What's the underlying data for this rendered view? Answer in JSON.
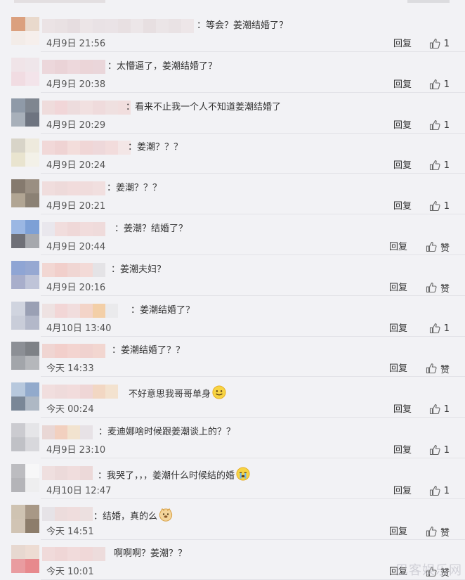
{
  "comments": [
    {
      "text": "：等会？姜潮结婚了？",
      "time": "4月9日 21:56",
      "reply": "回复",
      "like": "1",
      "emoji": ""
    },
    {
      "text": "：太懵逼了，姜潮结婚了？",
      "time": "4月9日 20:38",
      "reply": "回复",
      "like": "1",
      "emoji": ""
    },
    {
      "text": "：看来不止我一个人不知道姜潮结婚了",
      "time": "4月9日 20:29",
      "reply": "回复",
      "like": "1",
      "emoji": ""
    },
    {
      "text": "：姜潮？？？",
      "time": "4月9日 20:24",
      "reply": "回复",
      "like": "1",
      "emoji": ""
    },
    {
      "text": "：姜潮？？？",
      "time": "4月9日 20:21",
      "reply": "回复",
      "like": "1",
      "emoji": ""
    },
    {
      "text": "：姜潮？结婚了？",
      "time": "4月9日 20:44",
      "reply": "回复",
      "like": "赞",
      "emoji": ""
    },
    {
      "text": "：姜潮夫妇？",
      "time": "4月9日 20:16",
      "reply": "回复",
      "like": "赞",
      "emoji": ""
    },
    {
      "text": "：姜潮结婚了？",
      "time": "4月10日 13:40",
      "reply": "回复",
      "like": "1",
      "emoji": ""
    },
    {
      "text": "：姜潮结婚了？？",
      "time": "今天 14:33",
      "reply": "回复",
      "like": "赞",
      "emoji": ""
    },
    {
      "text": "不好意思我哥哥单身",
      "time": "今天 00:24",
      "reply": "回复",
      "like": "1",
      "emoji": "smile"
    },
    {
      "text": "：麦迪娜啥时候跟姜潮谈上的？？",
      "time": "4月9日 23:10",
      "reply": "回复",
      "like": "1",
      "emoji": ""
    },
    {
      "text": "：我哭了，，，姜潮什么时候结的婚",
      "time": "4月10日 12:47",
      "reply": "回复",
      "like": "1",
      "emoji": "cry"
    },
    {
      "text": "：结婚，真的么",
      "time": "今天 14:51",
      "reply": "回复",
      "like": "赞",
      "emoji": "doge"
    },
    {
      "text": "啊啊啊？姜潮？？",
      "time": "今天 10:01",
      "reply": "回复",
      "like": "赞",
      "emoji": ""
    }
  ],
  "watermark": "巴客娱乐网",
  "colors": {
    "background": "#f2f2f5",
    "text": "#333333",
    "time": "#555555"
  }
}
